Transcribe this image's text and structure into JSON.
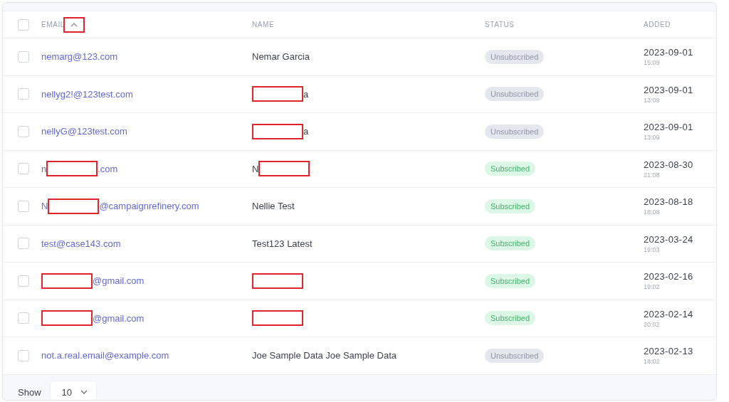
{
  "table": {
    "select_all": {
      "checked": false
    },
    "columns": [
      {
        "label": "EMAIL",
        "sorted": true
      },
      {
        "label": "NAME",
        "sorted": false
      },
      {
        "label": "STATUS",
        "sorted": false
      },
      {
        "label": "ADDED",
        "sorted": false
      }
    ],
    "rows": [
      {
        "checked": false,
        "email": [
          {
            "kind": "text",
            "text": "nemarg@123.com"
          }
        ],
        "name": [
          {
            "kind": "text",
            "text": "Nemar Garcia"
          }
        ],
        "status": {
          "kind": "unsubscribed",
          "label": "Unsubscribed"
        },
        "date": "2023-09-01",
        "time": "15:09"
      },
      {
        "checked": false,
        "email": [
          {
            "kind": "text",
            "text": "nellyg2!@123test.com"
          }
        ],
        "name": [
          {
            "kind": "redaction"
          },
          {
            "kind": "text",
            "text": "a"
          }
        ],
        "status": {
          "kind": "unsubscribed",
          "label": "Unsubscribed"
        },
        "date": "2023-09-01",
        "time": "13:09"
      },
      {
        "checked": false,
        "email": [
          {
            "kind": "text",
            "text": "nellyG@123test.com"
          }
        ],
        "name": [
          {
            "kind": "redaction"
          },
          {
            "kind": "text",
            "text": "a"
          }
        ],
        "status": {
          "kind": "unsubscribed",
          "label": "Unsubscribed"
        },
        "date": "2023-09-01",
        "time": "13:09"
      },
      {
        "checked": false,
        "email": [
          {
            "kind": "text",
            "text": "n"
          },
          {
            "kind": "redaction"
          },
          {
            "kind": "text",
            "text": ".com"
          }
        ],
        "name": [
          {
            "kind": "text",
            "text": "N"
          },
          {
            "kind": "redaction"
          }
        ],
        "status": {
          "kind": "subscribed",
          "label": "Subscribed"
        },
        "date": "2023-08-30",
        "time": "21:08"
      },
      {
        "checked": false,
        "email": [
          {
            "kind": "text",
            "text": "N"
          },
          {
            "kind": "redaction"
          },
          {
            "kind": "text",
            "text": "@campaignrefinery.com"
          }
        ],
        "name": [
          {
            "kind": "text",
            "text": "Nellie Test"
          }
        ],
        "status": {
          "kind": "subscribed",
          "label": "Subscribed"
        },
        "date": "2023-08-18",
        "time": "18:08"
      },
      {
        "checked": false,
        "email": [
          {
            "kind": "text",
            "text": "test@case143.com"
          }
        ],
        "name": [
          {
            "kind": "text",
            "text": "Test123 Latest"
          }
        ],
        "status": {
          "kind": "subscribed",
          "label": "Subscribed"
        },
        "date": "2023-03-24",
        "time": "19:03"
      },
      {
        "checked": false,
        "email": [
          {
            "kind": "redaction"
          },
          {
            "kind": "text",
            "text": "@gmail.com"
          }
        ],
        "name": [
          {
            "kind": "redaction"
          }
        ],
        "status": {
          "kind": "subscribed",
          "label": "Subscribed"
        },
        "date": "2023-02-16",
        "time": "19:02"
      },
      {
        "checked": false,
        "email": [
          {
            "kind": "redaction"
          },
          {
            "kind": "text",
            "text": "@gmail.com"
          }
        ],
        "name": [
          {
            "kind": "redaction"
          }
        ],
        "status": {
          "kind": "subscribed",
          "label": "Subscribed"
        },
        "date": "2023-02-14",
        "time": "20:02"
      },
      {
        "checked": false,
        "email": [
          {
            "kind": "text",
            "text": "not.a.real.email@example.com"
          }
        ],
        "name": [
          {
            "kind": "text",
            "text": "Joe Sample Data Joe Sample Data"
          }
        ],
        "status": {
          "kind": "unsubscribed",
          "label": "Unsubscribed"
        },
        "date": "2023-02-13",
        "time": "18:02"
      }
    ]
  },
  "footer": {
    "label": "Show",
    "page_size": "10"
  }
}
